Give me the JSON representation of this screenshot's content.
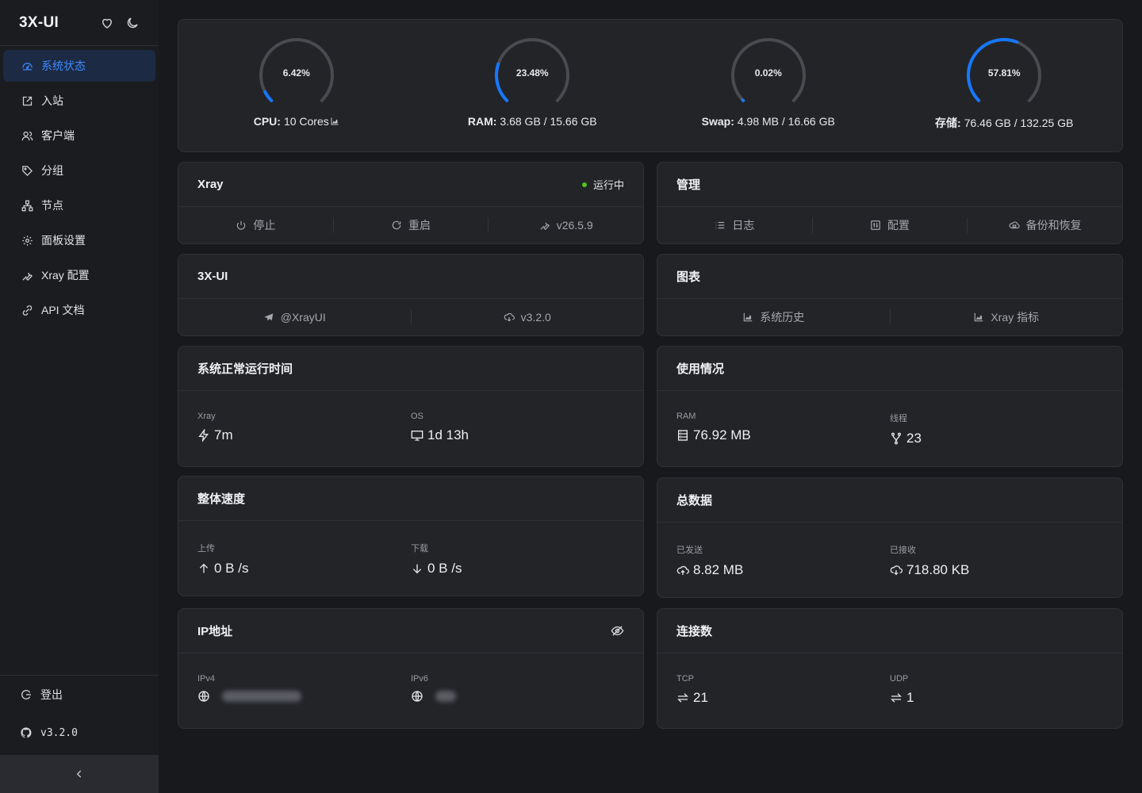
{
  "sidebar": {
    "brand": "3X-UI",
    "items": [
      {
        "label": "系统状态"
      },
      {
        "label": "入站"
      },
      {
        "label": "客户端"
      },
      {
        "label": "分组"
      },
      {
        "label": "节点"
      },
      {
        "label": "面板设置"
      },
      {
        "label": "Xray 配置"
      },
      {
        "label": "API 文档"
      }
    ],
    "logout": "登出",
    "version": "v3.2.0"
  },
  "gauges": [
    {
      "pct_text": "6.42%",
      "value": 6.42,
      "label_key": "CPU:",
      "label_value": "10 Cores"
    },
    {
      "pct_text": "23.48%",
      "value": 23.48,
      "label_key": "RAM:",
      "label_value": "3.68 GB / 15.66 GB"
    },
    {
      "pct_text": "0.02%",
      "value": 0.02,
      "label_key": "Swap:",
      "label_value": "4.98 MB / 16.66 GB"
    },
    {
      "pct_text": "57.81%",
      "value": 57.81,
      "label_key": "存储:",
      "label_value": "76.46 GB / 132.25 GB"
    }
  ],
  "xray": {
    "title": "Xray",
    "status": "运行中",
    "stop": "停止",
    "restart": "重启",
    "version": "v26.5.9"
  },
  "manage": {
    "title": "管理",
    "logs": "日志",
    "config": "配置",
    "backup": "备份和恢复"
  },
  "xui": {
    "title": "3X-UI",
    "telegram": "@XrayUI",
    "version": "v3.2.0"
  },
  "charts": {
    "title": "图表",
    "history": "系统历史",
    "metrics": "Xray 指标"
  },
  "uptime": {
    "title": "系统正常运行时间",
    "xray_label": "Xray",
    "xray_value": "7m",
    "os_label": "OS",
    "os_value": "1d 13h"
  },
  "usage": {
    "title": "使用情况",
    "ram_label": "RAM",
    "ram_value": "76.92 MB",
    "threads_label": "线程",
    "threads_value": "23"
  },
  "speed": {
    "title": "整体速度",
    "up_label": "上传",
    "up_value": "0 B /s",
    "down_label": "下载",
    "down_value": "0 B /s"
  },
  "total": {
    "title": "总数据",
    "sent_label": "已发送",
    "sent_value": "8.82 MB",
    "recv_label": "已接收",
    "recv_value": "718.80 KB"
  },
  "ip": {
    "title": "IP地址",
    "v4_label": "IPv4",
    "v6_label": "IPv6"
  },
  "conn": {
    "title": "连接数",
    "tcp_label": "TCP",
    "tcp_value": "21",
    "udp_label": "UDP",
    "udp_value": "1"
  },
  "colors": {
    "accent": "#1677ff",
    "running": "#52c41a",
    "track": "#4a4b50"
  }
}
